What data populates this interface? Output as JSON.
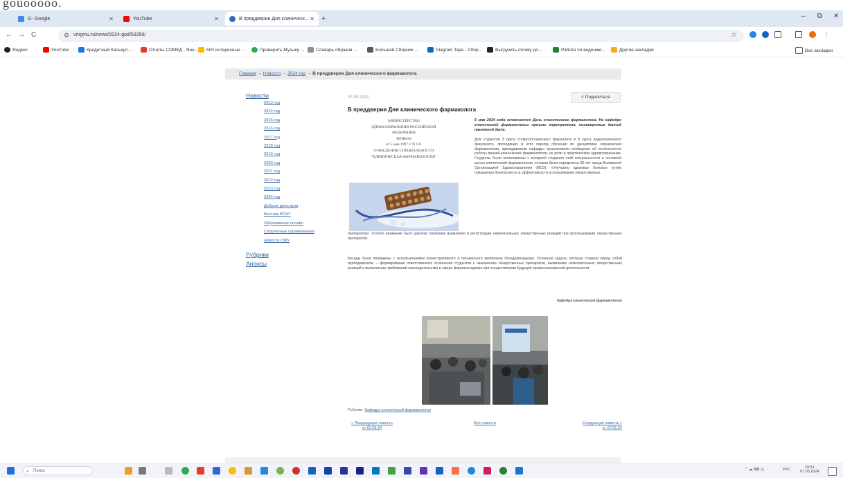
{
  "page_top_text": "gouooooo.",
  "tabs": [
    {
      "label": "G- Google",
      "favicon_color": "#4285f4"
    },
    {
      "label": "YouTube",
      "favicon_color": "#ff0000"
    },
    {
      "label": "В преддверии Дня клиническ...",
      "favicon_color": "#2a6cc4",
      "active": true
    }
  ],
  "window_controls": {
    "minimize": "–",
    "maximize": "⧉",
    "close": "✕"
  },
  "toolbar": {
    "url": "vmgmu.ru/news/2024-god/53350/",
    "back": "←",
    "forward": "→",
    "reload": "C",
    "star": "☆"
  },
  "bookmarks": [
    {
      "label": "Яндекс",
      "color": "#222"
    },
    {
      "label": "YouTube",
      "color": "#ff0000"
    },
    {
      "label": "Кредитный Калькул. ...",
      "color": "#1a73e8"
    },
    {
      "label": "Отчеты СОМЕД - Яне...",
      "color": "#e53935"
    },
    {
      "label": "500 интересных ...",
      "color": "#fbbc04"
    },
    {
      "label": "Проверить Музыку ...",
      "color": "#34a853"
    },
    {
      "label": "Словарь образов ...",
      "color": "#8e8e8e"
    },
    {
      "label": "Большой Сборник ...",
      "color": "#555"
    },
    {
      "label": "Diagram Tape - Сбор...",
      "color": "#1565c0"
    },
    {
      "label": "Выгрузить голову до...",
      "color": "#222"
    },
    {
      "label": "Работа по ведению...",
      "color": "#2e7d32"
    },
    {
      "label": "Другие закладки",
      "color": "#f9a825"
    },
    {
      "label": "Все закладки",
      "color": "#555"
    }
  ],
  "breadcrumb": [
    "Главная",
    "Новости",
    "2024 год",
    "В преддверии Дня клинического фармаколога"
  ],
  "sidebar": {
    "news_heading": "Новости",
    "items": [
      "2013 год",
      "2014 год",
      "2015 год",
      "2016 год",
      "2017 год",
      "2018 год",
      "2019 год",
      "2020 год",
      "2021 год",
      "2022 год",
      "2023 год",
      "2024 год",
      "Добрые дела вуза",
      "Вестник ВГМУ",
      "Образование онлайн",
      "Спортивные соревнования",
      "Новости ОМУ"
    ],
    "rubrics_heading": "Рубрики",
    "announcements_heading": "Анонсы"
  },
  "article": {
    "date": "07.05.2024",
    "share_label": "Поделиться",
    "title": "В преддверии Дня клинического фармаколога",
    "doc_lines": [
      "МИНИСТЕРСТВО",
      "ЗДРАВООХРАНЕНИЯ РОССИЙСКОЙ",
      "ФЕДЕРАЦИИ",
      "ПРИКАЗ",
      "от 5 мая 1997 г. N 131",
      "О ВВЕДЕНИИ СПЕЦИАЛЬНОСТИ",
      "\"КЛИНИЧЕСКАЯ ФАРМАКОЛОГИЯ\""
    ],
    "lead": "5 мая 2024 года отмечается День клинического фармаколога. На кафедре клинической фармакологии прошли мероприятия, посвященные данной памятной дате.",
    "para1": "Для студентов 3 курса стоматологического факультета и 6 курса педиатрического факультета, проходящих в этот период обучения по дисциплине клиническая фармакология, преподаватели кафедры организовали сообщения об особенностях работы врачей-клинических фармакологов, их роли в практическом здравоохранении. Студенты были ознакомлены с историей создания этой специальности и основной целью клинической фармакологии, которая была определена 30 лет назад Всемирной Организацией Здравоохранения (ВОЗ): «Улучшить здоровье больных путем повышения безопасности и эффективности использования лекарственных",
    "para1_cont": "препаратов». Особое внимание было уделено проблеме выявления и регистрации нежелательных лекарственных реакций при использовании лекарственных препаратов.",
    "para2": "Беседы были проведены с использованием иллюстративного и письменного материала Росздравнадзора. Основная задача, которую ставили перед собой преподаватели, – формирование ответственного отношения студентов к назначению лекарственных препаратов, выявлению нежелательных лекарственных реакций и выполнению требований законодательства в сфере фармаконадзора при осуществлении будущей профессиональной деятельности.",
    "signature": "Кафедра клинической фармакологии",
    "rubric_label": "Рубрики:",
    "rubric_link": "Кафедра клинической фармакологии",
    "prev_label": "« Предыдущая новость",
    "prev_date": "от 02.05.24",
    "all_label": "Все новости",
    "next_label": "Следующая новость »",
    "next_date": "от 07.05.24"
  },
  "taskbar": {
    "search_placeholder": "Поиск",
    "icons": [
      "#e8a02c",
      "#7a7a7a",
      "#33a852",
      "#e53935",
      "#3367d6",
      "#fbbc04",
      "#d49b30",
      "#1e88e5",
      "#7cb342",
      "#d32f2f",
      "#1565c0",
      "#0d47a1",
      "#283593",
      "#1a237e",
      "#0277bd",
      "#43a047",
      "#3949ab",
      "#5e35b1",
      "#1565c0",
      "#ff7043",
      "#1e88e5",
      "#d81b60",
      "#2e7d32",
      "#1976d2"
    ],
    "lang": "РУС",
    "time": "10:51",
    "date": "07.05.2024"
  }
}
